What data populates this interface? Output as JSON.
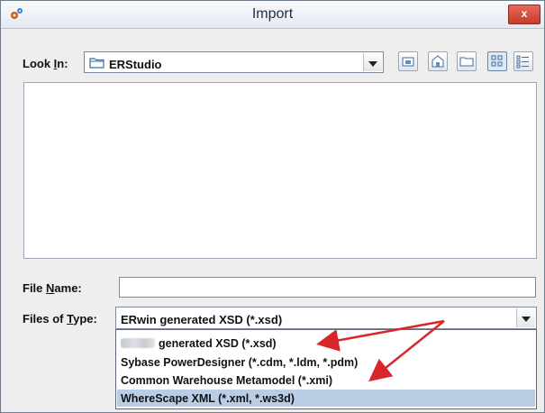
{
  "window": {
    "title": "Import",
    "close_label": "x",
    "icon": "app-gear-icon"
  },
  "look_in": {
    "label_prefix": "Look ",
    "label_underlined": "I",
    "label_suffix": "n:",
    "value": "ERStudio",
    "folder_icon": "folder-icon"
  },
  "toolbar": {
    "icons": [
      "up-folder-icon",
      "home-icon",
      "new-folder-icon",
      "list-view-icon",
      "details-view-icon"
    ]
  },
  "file_name": {
    "label_prefix": "File ",
    "label_underlined": "N",
    "label_suffix": "ame:",
    "value": ""
  },
  "files_of_type": {
    "label_prefix": "Files of ",
    "label_underlined": "T",
    "label_suffix": "ype:",
    "selected": "ERwin generated XSD (*.xsd)",
    "options": [
      {
        "label": "generated XSD (*.xsd)",
        "has_redacted_prefix": true
      },
      {
        "label": "Sybase PowerDesigner (*.cdm, *.ldm, *.pdm)"
      },
      {
        "label": "Common Warehouse Metamodel (*.xmi)"
      },
      {
        "label": "WhereScape XML (*.xml, *.ws3d)",
        "highlighted": true
      }
    ]
  },
  "colors": {
    "window_bg": "#eeeeee",
    "highlight": "#b9cde4",
    "arrow": "#d9262c",
    "close_button": "#c94a3a"
  }
}
